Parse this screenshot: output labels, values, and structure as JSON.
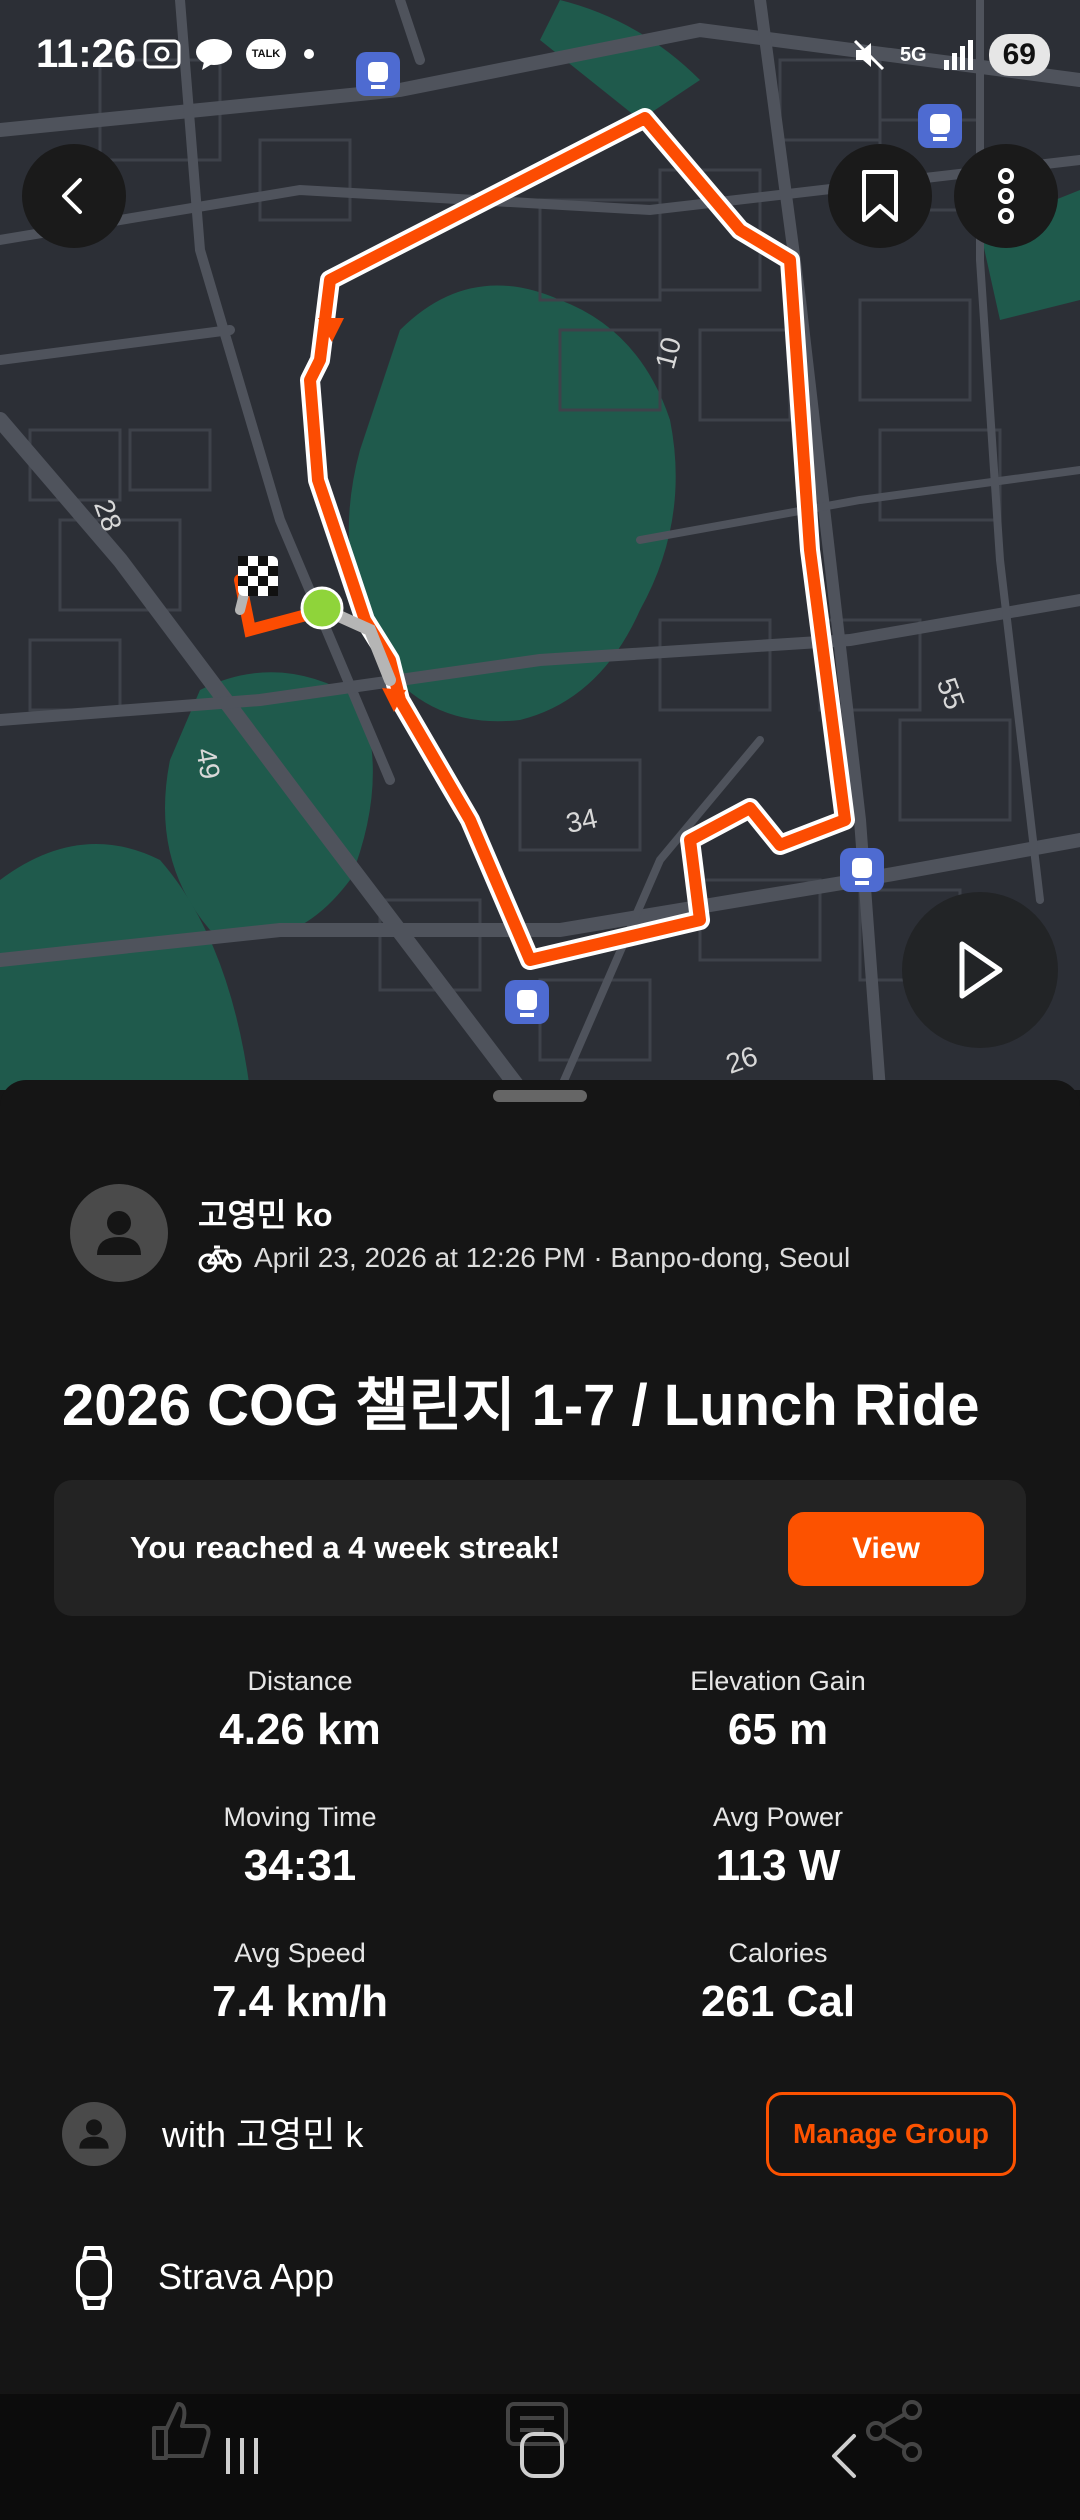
{
  "status_bar": {
    "time": "11:26",
    "talk_badge": "TALK",
    "network": "5G",
    "battery": "69"
  },
  "map": {
    "street_labels": [
      "10",
      "28",
      "49",
      "34",
      "55",
      "26"
    ],
    "route_color": "#fc4c02",
    "water_color": "#1f5a4c"
  },
  "athlete": {
    "name": "고영민 ko",
    "date_location": "April 23, 2026 at 12:26 PM · Banpo-dong, Seoul",
    "activity_icon": "bike-icon"
  },
  "activity": {
    "title": "2026 COG 챌린지 1-7 / Lunch Ride"
  },
  "streak": {
    "text": "You reached a 4 week streak!",
    "button": "View"
  },
  "stats": [
    {
      "label": "Distance",
      "value": "4.26 km"
    },
    {
      "label": "Elevation Gain",
      "value": "65 m"
    },
    {
      "label": "Moving Time",
      "value": "34:31"
    },
    {
      "label": "Avg Power",
      "value": "113 W"
    },
    {
      "label": "Avg Speed",
      "value": "7.4 km/h"
    },
    {
      "label": "Calories",
      "value": "261 Cal"
    }
  ],
  "group": {
    "text": "with 고영민 k",
    "button": "Manage Group"
  },
  "device": {
    "text": "Strava App"
  },
  "colors": {
    "accent": "#fc5200",
    "sheet_bg": "#151515",
    "card_bg": "#232323"
  }
}
